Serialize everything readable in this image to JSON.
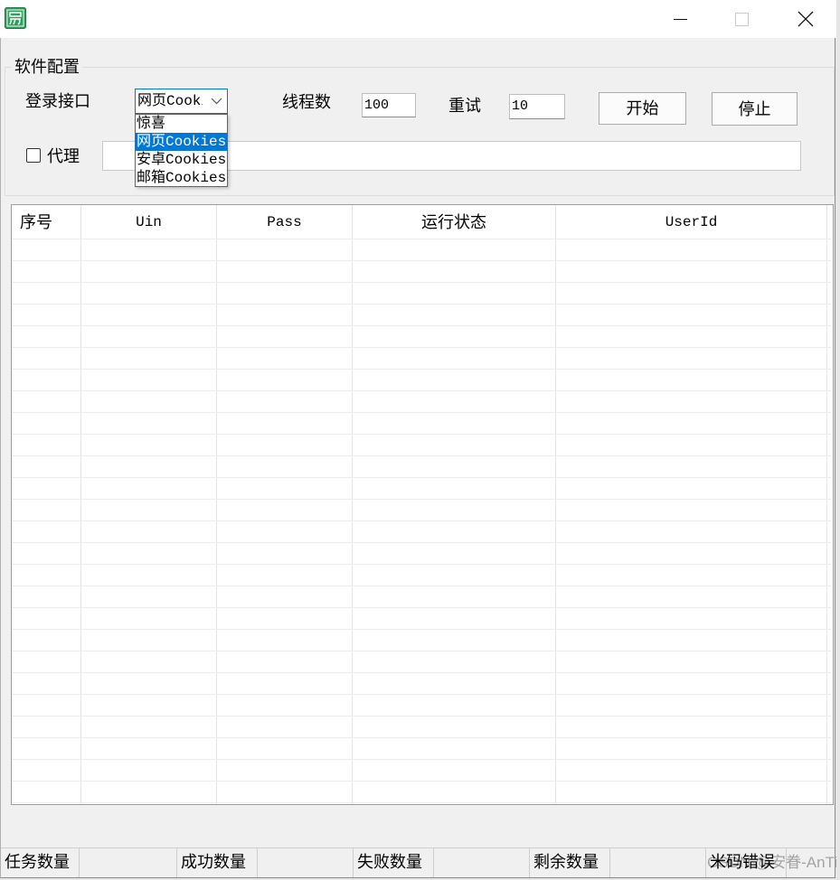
{
  "icons": {
    "app": "app-icon",
    "minimize": "minimize-icon",
    "maximize": "maximize-icon",
    "close": "close-icon",
    "dropdown": "chevron-down-icon",
    "checkbox": "checkbox-icon"
  },
  "colors": {
    "accent": "#0078d7",
    "window_bg": "#f0f0f0",
    "app_icon": "#2f9e5d"
  },
  "config": {
    "group_title": "软件配置",
    "login_label": "登录接口",
    "login_selected": "网页Cookies",
    "login_options": [
      "惊喜",
      "网页Cookies",
      "安卓Cookies",
      "邮箱Cookies"
    ],
    "login_highlighted_index": 1,
    "threads_label": "线程数",
    "threads_value": "100",
    "retry_label": "重试",
    "retry_value": "10",
    "start_label": "开始",
    "stop_label": "停止",
    "proxy_label": "代理",
    "proxy_checked": false,
    "proxy_value": ""
  },
  "table": {
    "columns": [
      "序号",
      "Uin",
      "Pass",
      "运行状态",
      "UserId"
    ],
    "rows": []
  },
  "statusbar": {
    "items": [
      {
        "label": "任务数量",
        "value": ""
      },
      {
        "label": "成功数量",
        "value": ""
      },
      {
        "label": "失败数量",
        "value": ""
      },
      {
        "label": "剩余数量",
        "value": ""
      },
      {
        "label": "米码错误",
        "value": ""
      }
    ]
  },
  "watermark": "CSDN @安眷-AnTi"
}
